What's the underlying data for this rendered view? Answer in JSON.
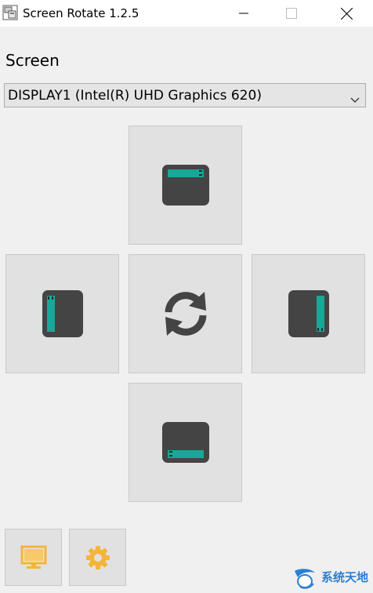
{
  "window": {
    "title": "Screen Rotate 1.2.5"
  },
  "screen_section": {
    "label": "Screen",
    "selected_display": "DISPLAY1 (Intel(R) UHD Graphics 620)"
  },
  "rotation_buttons": [
    {
      "name": "rotate-landscape",
      "icon": "monitor-landscape-icon"
    },
    {
      "name": "rotate-portrait",
      "icon": "monitor-portrait-icon"
    },
    {
      "name": "rotate-auto",
      "icon": "sync-icon"
    },
    {
      "name": "rotate-portrait-flipped",
      "icon": "monitor-portrait-flipped-icon"
    },
    {
      "name": "rotate-landscape-flipped",
      "icon": "monitor-landscape-flipped-icon"
    }
  ],
  "bottom_buttons": [
    {
      "name": "display",
      "icon": "monitor-icon"
    },
    {
      "name": "settings",
      "icon": "gear-icon"
    }
  ],
  "watermark": {
    "text": "系统天地"
  },
  "colors": {
    "accent_teal": "#17a89a",
    "monitor_dark": "#444444",
    "icon_orange": "#f5b53a",
    "watermark_blue": "#2b7fd4"
  }
}
